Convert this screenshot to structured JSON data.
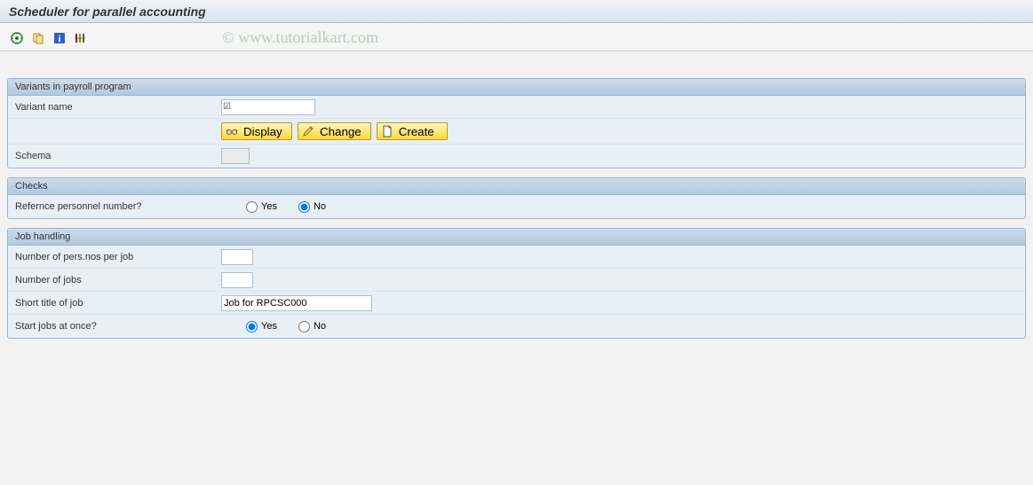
{
  "title": "Scheduler for parallel accounting",
  "watermark": "© www.tutorialkart.com",
  "panels": {
    "variants": {
      "title": "Variants in payroll program",
      "variant_name_label": "Variant name",
      "variant_name_value": "",
      "schema_label": "Schema",
      "schema_value": "",
      "buttons": {
        "display": "Display",
        "change": "Change",
        "create": "Create"
      }
    },
    "checks": {
      "title": "Checks",
      "ref_pers_label": "Refernce personnel number?",
      "yes": "Yes",
      "no": "No",
      "selected": "no"
    },
    "job": {
      "title": "Job handling",
      "num_pers_label": "Number of pers.nos per job",
      "num_pers_value": "",
      "num_jobs_label": "Number of jobs",
      "num_jobs_value": "",
      "short_title_label": "Short title of job",
      "short_title_value": "Job for RPCSC000",
      "start_label": "Start jobs at once?",
      "yes": "Yes",
      "no": "No",
      "selected": "yes"
    }
  }
}
